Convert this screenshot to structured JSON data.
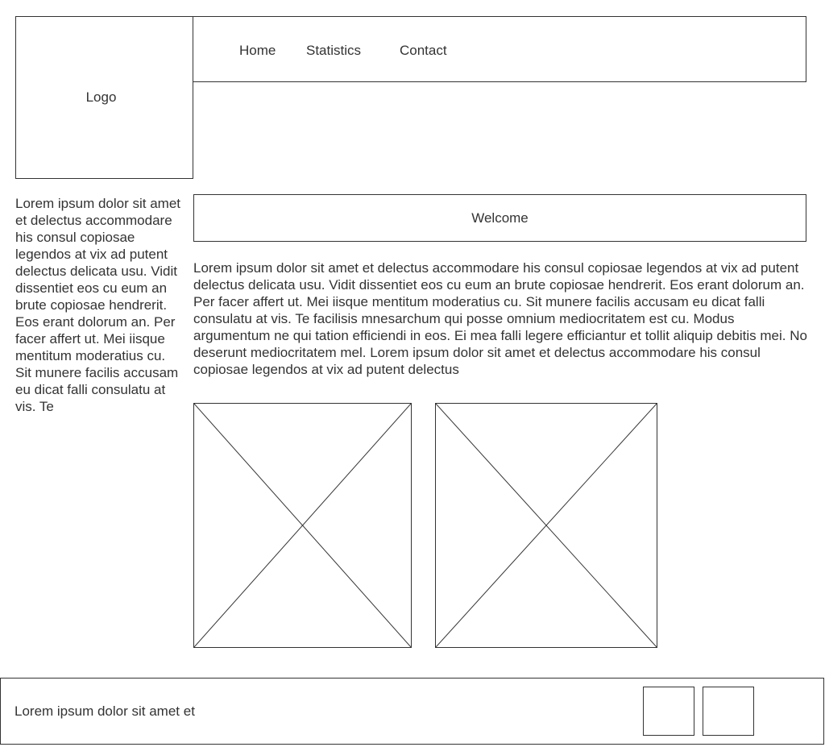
{
  "logo": {
    "label": "Logo"
  },
  "nav": {
    "items": [
      {
        "label": "Home"
      },
      {
        "label": "Statistics"
      },
      {
        "label": "Contact"
      }
    ]
  },
  "sidebar": {
    "text": "Lorem ipsum dolor sit amet et delectus accommodare his consul copiosae legendos at vix ad putent delectus delicata usu. Vidit dissentiet eos cu eum an brute copiosae hendrerit. Eos erant dolorum an. Per facer affert ut. Mei iisque mentitum moderatius cu. Sit munere facilis accusam eu dicat falli consulatu at vis. Te"
  },
  "main": {
    "welcome": "Welcome",
    "body": "Lorem ipsum dolor sit amet et delectus accommodare his consul copiosae legendos at vix ad putent delectus delicata usu. Vidit dissentiet eos cu eum an brute copiosae hendrerit. Eos erant dolorum an. Per facer affert ut. Mei iisque mentitum moderatius cu. Sit munere facilis accusam eu dicat falli consulatu at vis. Te facilisis mnesarchum qui posse omnium mediocritatem est cu. Modus argumentum ne qui tation efficiendi in eos. Ei mea falli legere efficiantur et tollit aliquip debitis mei. No deserunt mediocritatem mel. Lorem ipsum dolor sit amet et delectus accommodare his consul copiosae legendos at vix ad putent delectus"
  },
  "footer": {
    "text": "Lorem ipsum dolor sit amet et"
  },
  "colors": {
    "stroke": "#333333",
    "background": "#ffffff"
  }
}
